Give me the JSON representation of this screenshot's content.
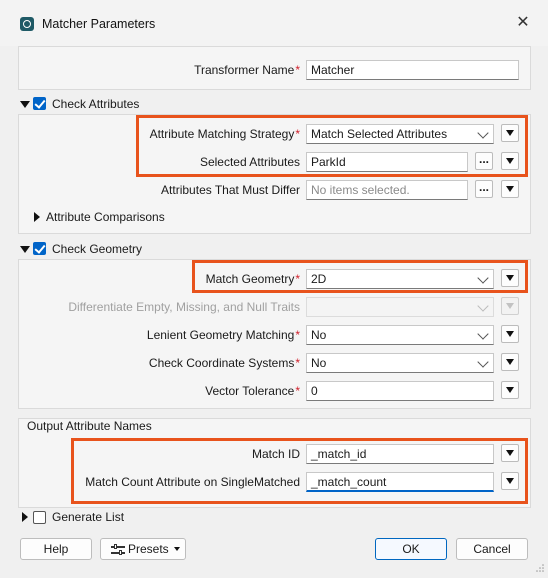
{
  "window": {
    "title": "Matcher Parameters",
    "close_glyph": "✕"
  },
  "transformer_name": {
    "label": "Transformer Name",
    "value": "Matcher"
  },
  "check_attributes": {
    "label": "Check Attributes",
    "checked": true,
    "strategy": {
      "label": "Attribute Matching Strategy",
      "value": "Match Selected Attributes"
    },
    "selected": {
      "label": "Selected Attributes",
      "value": "ParkId"
    },
    "must_differ": {
      "label": "Attributes That Must Differ",
      "placeholder": "No items selected."
    },
    "comparisons": {
      "label": "Attribute Comparisons"
    }
  },
  "check_geometry": {
    "label": "Check Geometry",
    "checked": true,
    "match_geometry": {
      "label": "Match Geometry",
      "value": "2D"
    },
    "differentiate": {
      "label": "Differentiate Empty, Missing, and Null Traits",
      "value": ""
    },
    "lenient": {
      "label": "Lenient Geometry Matching",
      "value": "No"
    },
    "coord_systems": {
      "label": "Check Coordinate Systems",
      "value": "No"
    },
    "vector_tolerance": {
      "label": "Vector Tolerance",
      "value": "0"
    }
  },
  "output": {
    "title": "Output Attribute Names",
    "match_id": {
      "label": "Match ID",
      "value": "_match_id"
    },
    "match_count": {
      "label": "Match Count Attribute on SingleMatched",
      "value": "_match_count"
    }
  },
  "generate_list": {
    "label": "Generate List",
    "checked": false
  },
  "buttons": {
    "help": "Help",
    "presets": "Presets",
    "ok": "OK",
    "cancel": "Cancel"
  },
  "required_marker": "*",
  "ellipsis": "...",
  "colors": {
    "accent": "#0064c8",
    "highlight": "#e8531c",
    "required": "#d0202c"
  }
}
